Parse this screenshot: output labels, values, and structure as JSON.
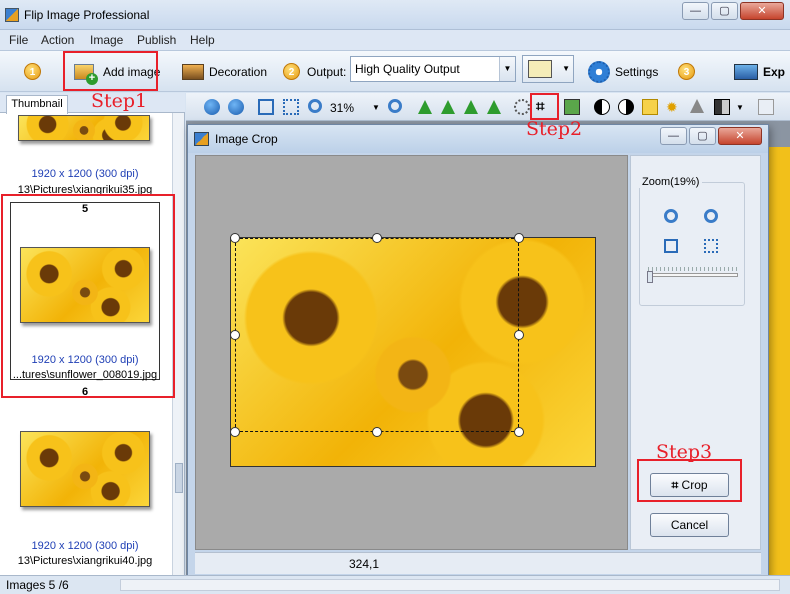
{
  "window": {
    "title": "Flip Image Professional",
    "btn_min": "—",
    "btn_max": "▢",
    "btn_close": "✕"
  },
  "menu": [
    "File",
    "Action",
    "Image",
    "Publish",
    "Help"
  ],
  "toolbar": {
    "badges": [
      "1",
      "2",
      "3"
    ],
    "add_image": "Add image",
    "decoration": "Decoration",
    "output_label": "Output:",
    "output_value": "High Quality Output",
    "settings": "Settings",
    "export_partial": "Exp"
  },
  "annotations": {
    "step1": "Step1",
    "step2": "Step2",
    "step3": "Step3"
  },
  "thumbnails": {
    "tab": "Thumbnail",
    "items": [
      {
        "info": "1920 x 1200 (300 dpi)",
        "path": "13\\Pictures\\xiangrikui35.jpg",
        "number": "5"
      },
      {
        "info": "1920 x 1200 (300 dpi)",
        "path": "...tures\\sunflower_008019.jpg",
        "number": "6"
      },
      {
        "info": "1920 x 1200 (300 dpi)",
        "path": "13\\Pictures\\xiangrikui40.jpg"
      }
    ]
  },
  "image_tools": {
    "zoom_value": "31%"
  },
  "dialog": {
    "title": "Image Crop",
    "zoom_label": "Zoom(19%)",
    "crop_button": "Crop",
    "cancel_button": "Cancel",
    "coords": "324,1"
  },
  "status": {
    "images": "Images 5 /6"
  },
  "colors": {
    "annotation_red": "#e8202a",
    "workspace_gray": "#aaaaaa",
    "dialog_blue": "#c4d5ea"
  }
}
